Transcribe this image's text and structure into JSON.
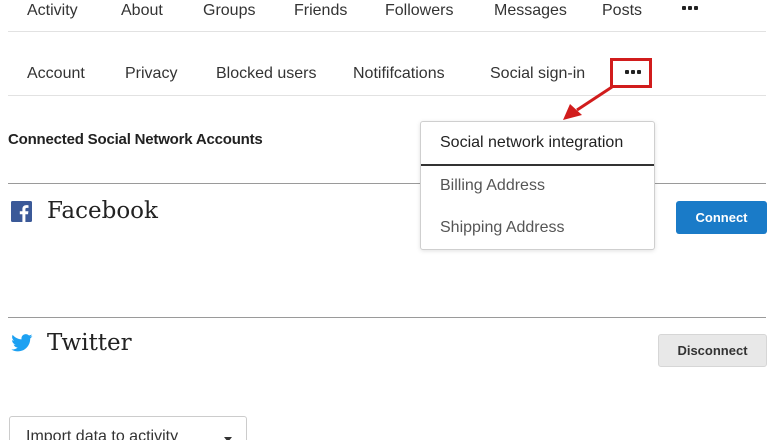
{
  "profile_nav": {
    "items": [
      {
        "label": "Activity"
      },
      {
        "label": "About"
      },
      {
        "label": "Groups"
      },
      {
        "label": "Friends"
      },
      {
        "label": "Followers"
      },
      {
        "label": "Messages"
      },
      {
        "label": "Posts"
      }
    ],
    "more_icon": "more-dots-icon"
  },
  "settings_nav": {
    "items": [
      {
        "label": "Account"
      },
      {
        "label": "Privacy"
      },
      {
        "label": "Blocked users"
      },
      {
        "label": "Notififcations"
      },
      {
        "label": "Social sign-in"
      }
    ],
    "more_icon": "more-dots-icon",
    "highlight_color": "#d11c1c"
  },
  "dropdown": {
    "items": [
      {
        "label": "Social network integration",
        "active": true
      },
      {
        "label": "Billing Address"
      },
      {
        "label": "Shipping Address"
      }
    ]
  },
  "section": {
    "title": "Connected Social Network Accounts"
  },
  "accounts": [
    {
      "name": "Facebook",
      "icon": "facebook-icon",
      "action": "Connect",
      "icon_color": "#3b5998"
    },
    {
      "name": "Twitter",
      "icon": "twitter-icon",
      "action": "Disconnect",
      "icon_color": "#1da1f2"
    }
  ],
  "import": {
    "label": "Import data to activity"
  },
  "colors": {
    "primary_button": "#1a7bc8",
    "secondary_button": "#e8e8e8",
    "annotation": "#d11c1c"
  }
}
